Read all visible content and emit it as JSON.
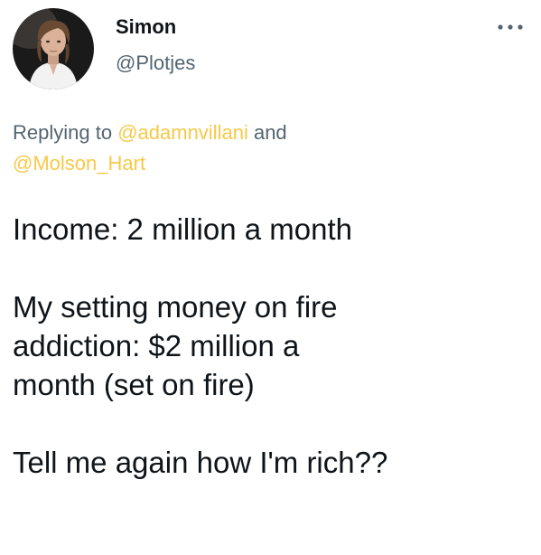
{
  "tweet": {
    "author": {
      "display_name": "Simon",
      "handle": "@Plotjes",
      "avatar_icon": "profile-photo"
    },
    "more_icon": "more-horizontal-icon",
    "reply_context": {
      "prefix": "Replying to",
      "mentions": [
        "@adamnvillani",
        "@Molson_Hart"
      ],
      "conjunction": "and"
    },
    "body": {
      "paragraphs": [
        [
          "Income: 2 million a month"
        ],
        [
          "My setting money on fire",
          "addiction: $2 million a",
          "month (set on fire)"
        ],
        [
          "Tell me again how I'm rich??"
        ]
      ]
    }
  },
  "colors": {
    "text_primary": "#0f1419",
    "text_secondary": "#536471",
    "mention": "#f7c948",
    "background": "#ffffff"
  }
}
